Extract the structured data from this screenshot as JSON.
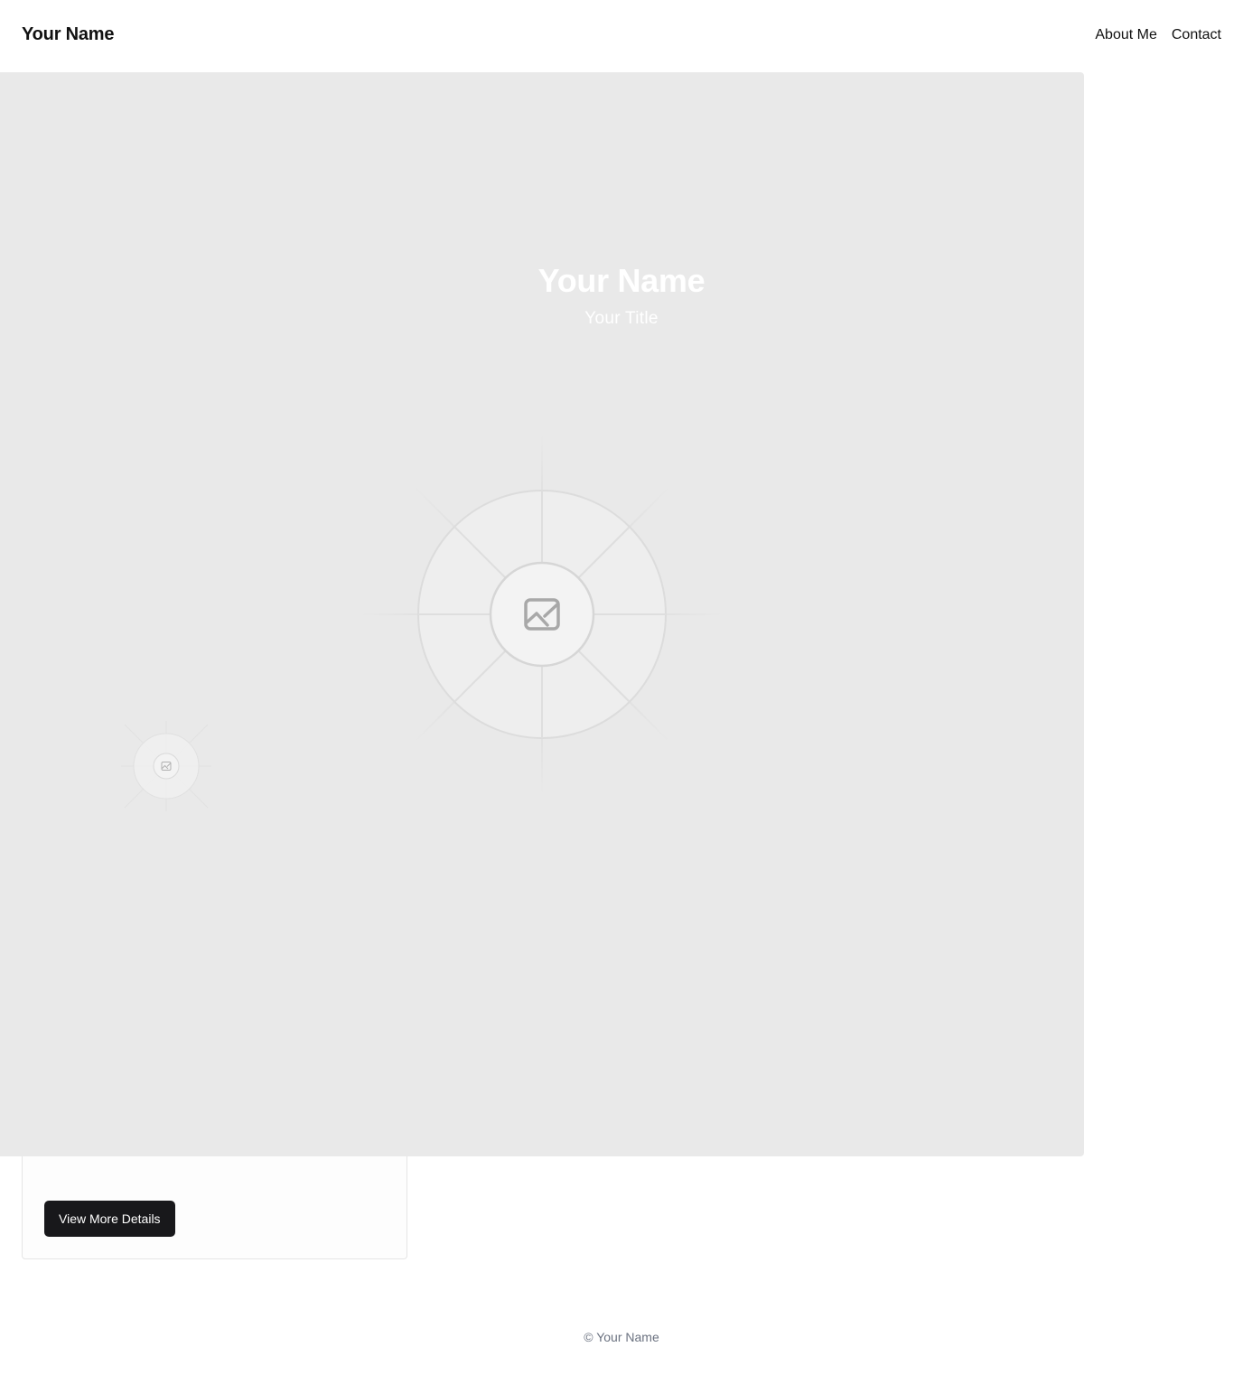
{
  "header": {
    "brand": "Your Name",
    "nav": [
      "About Me",
      "Contact"
    ]
  },
  "hero": {
    "name": "Your Name",
    "title": "Your Title",
    "background_color": "#e9e9e9",
    "main_image_icon": "image-placeholder-icon",
    "secondary_image_icon": "image-placeholder-icon"
  },
  "card": {
    "button_label": "View More Details"
  },
  "footer": {
    "copyright": "© Your Name"
  },
  "colors": {
    "button_bg": "#18181b",
    "footer_text": "#6b7280"
  }
}
